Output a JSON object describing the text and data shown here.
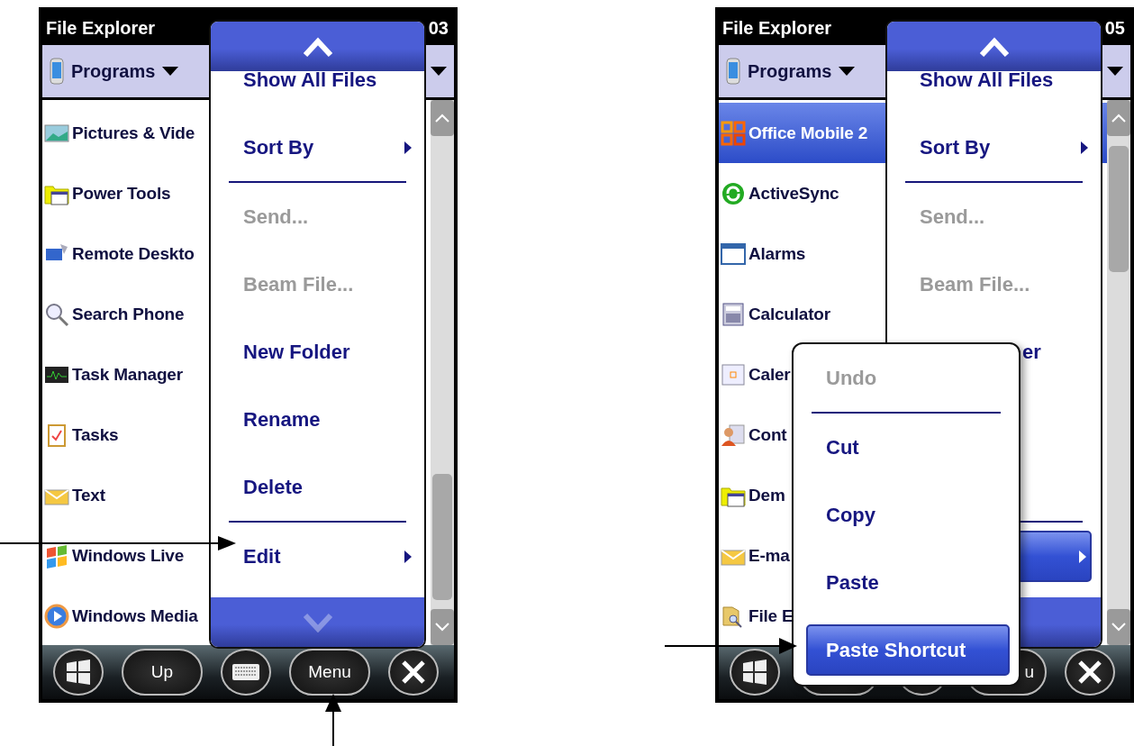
{
  "screens": [
    {
      "status_bar": {
        "title": "File Explorer",
        "time": "03"
      },
      "folder_picker": {
        "label": "Programs"
      },
      "files": [
        {
          "name": "Pictures & Vide",
          "kind": "picture",
          "selected": false
        },
        {
          "name": "Power Tools",
          "kind": "folder",
          "selected": false
        },
        {
          "name": "Remote Deskto",
          "kind": "remote",
          "selected": false
        },
        {
          "name": "Search Phone",
          "kind": "search",
          "selected": false
        },
        {
          "name": "Task Manager",
          "kind": "monitor",
          "selected": false
        },
        {
          "name": "Tasks",
          "kind": "tasks",
          "selected": false
        },
        {
          "name": "Text",
          "kind": "mail",
          "selected": false
        },
        {
          "name": "Windows Live",
          "kind": "flag",
          "selected": false
        },
        {
          "name": "Windows Media",
          "kind": "media",
          "selected": false
        }
      ],
      "soft_keys": [
        {
          "kind": "windows"
        },
        {
          "kind": "text",
          "label": "Up"
        },
        {
          "kind": "keyboard"
        },
        {
          "kind": "text",
          "label": "Menu"
        },
        {
          "kind": "close"
        }
      ],
      "menu": {
        "items": [
          {
            "kind": "item",
            "label": "Show All Files",
            "disabled": false,
            "submenu": false,
            "selected": false
          },
          {
            "kind": "item",
            "label": "Sort By",
            "disabled": false,
            "submenu": true,
            "selected": false
          },
          {
            "kind": "separator"
          },
          {
            "kind": "item",
            "label": "Send...",
            "disabled": true,
            "submenu": false,
            "selected": false
          },
          {
            "kind": "item",
            "label": "Beam File...",
            "disabled": true,
            "submenu": false,
            "selected": false
          },
          {
            "kind": "item",
            "label": "New Folder",
            "disabled": false,
            "submenu": false,
            "selected": false
          },
          {
            "kind": "item",
            "label": "Rename",
            "disabled": false,
            "submenu": false,
            "selected": false
          },
          {
            "kind": "item",
            "label": "Delete",
            "disabled": false,
            "submenu": false,
            "selected": false
          },
          {
            "kind": "separator"
          },
          {
            "kind": "item",
            "label": "Edit",
            "disabled": false,
            "submenu": true,
            "selected": false
          }
        ]
      }
    },
    {
      "status_bar": {
        "title": "File Explorer",
        "time": "05"
      },
      "folder_picker": {
        "label": "Programs"
      },
      "files": [
        {
          "name": "Office Mobile 2",
          "kind": "office",
          "selected": true
        },
        {
          "name": "ActiveSync",
          "kind": "sync",
          "selected": false
        },
        {
          "name": "Alarms",
          "kind": "window",
          "selected": false
        },
        {
          "name": "Calculator",
          "kind": "calculator",
          "selected": false
        },
        {
          "name": "Caler",
          "kind": "calendar",
          "selected": false
        },
        {
          "name": "Cont",
          "kind": "contact",
          "selected": false
        },
        {
          "name": "Dem",
          "kind": "folder",
          "selected": false
        },
        {
          "name": "E-ma",
          "kind": "mail",
          "selected": false
        },
        {
          "name": "File E",
          "kind": "explorer",
          "selected": false
        }
      ],
      "soft_keys": [
        {
          "kind": "windows"
        },
        {
          "kind": "blank"
        },
        {
          "kind": "round"
        },
        {
          "kind": "text",
          "label": "u"
        },
        {
          "kind": "close"
        }
      ],
      "menu": {
        "items": [
          {
            "kind": "item",
            "label": "Show All Files",
            "disabled": false,
            "submenu": false,
            "selected": false
          },
          {
            "kind": "item",
            "label": "Sort By",
            "disabled": false,
            "submenu": true,
            "selected": false
          },
          {
            "kind": "separator"
          },
          {
            "kind": "item",
            "label": "Send...",
            "disabled": true,
            "submenu": false,
            "selected": false
          },
          {
            "kind": "item",
            "label": "Beam File...",
            "disabled": true,
            "submenu": false,
            "selected": false
          },
          {
            "kind": "partial",
            "label": "er",
            "disabled": false,
            "submenu": false,
            "selected": false
          },
          {
            "kind": "hidden"
          },
          {
            "kind": "hidden"
          },
          {
            "kind": "separator"
          },
          {
            "kind": "item",
            "disabled": false,
            "submenu": true,
            "selected": true
          }
        ]
      },
      "submenu": {
        "items": [
          {
            "kind": "item",
            "label": "Undo",
            "disabled": true,
            "submenu": false,
            "selected": false
          },
          {
            "kind": "separator"
          },
          {
            "kind": "item",
            "label": "Cut",
            "disabled": false,
            "submenu": false,
            "selected": false
          },
          {
            "kind": "item",
            "label": "Copy",
            "disabled": false,
            "submenu": false,
            "selected": false
          },
          {
            "kind": "item",
            "label": "Paste",
            "disabled": false,
            "submenu": false,
            "selected": false
          },
          {
            "kind": "item",
            "label": "Paste Shortcut",
            "disabled": false,
            "submenu": false,
            "selected": true
          }
        ]
      }
    }
  ]
}
